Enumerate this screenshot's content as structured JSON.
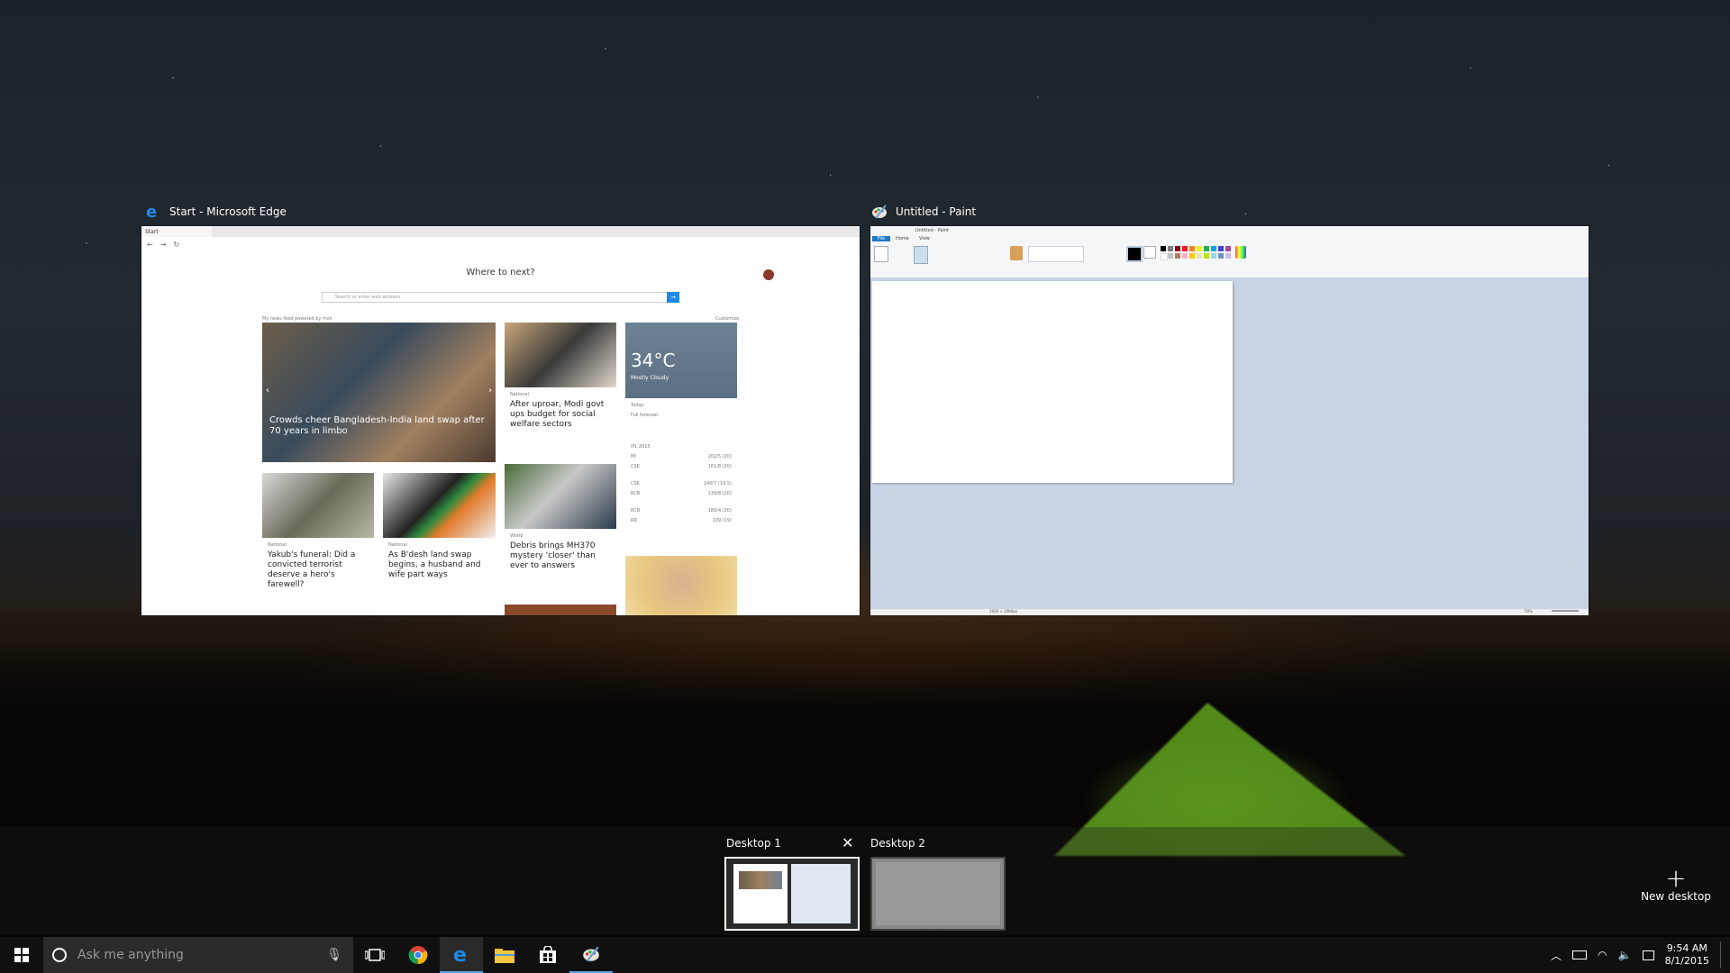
{
  "windows": [
    {
      "title": "Start - Microsoft Edge",
      "icon": "edge-icon"
    },
    {
      "title": "Untitled - Paint",
      "icon": "paint-icon"
    }
  ],
  "edge": {
    "tab_label": "Start",
    "heading": "Where to next?",
    "search_placeholder": "Search or enter web address",
    "feed_label": "My news feed",
    "feed_powered": "powered by msn",
    "customize": "Customize",
    "headline_main": "Crowds cheer Bangladesh-India land swap after 70 years in limbo",
    "story2": {
      "category": "National",
      "title": "After uproar, Modi govt ups budget for social welfare sectors"
    },
    "story3": {
      "category": "National",
      "title": "Yakub's funeral: Did a convicted terrorist deserve a hero's farewell?"
    },
    "story4": {
      "category": "National",
      "title": "As B'desh land swap begins, a husband and wife part ways"
    },
    "story5": {
      "category": "World",
      "title": "Debris brings MH370 mystery 'closer' than ever to answers"
    },
    "weather": {
      "temp": "34°C",
      "condition": "Mostly Cloudy",
      "today": "Today",
      "forecast": "Full forecast"
    },
    "ipl_label": "IPL 2015",
    "scores": [
      {
        "team": "MI",
        "score": "202/5 (20)"
      },
      {
        "team": "CSK",
        "score": "161/8 (20)"
      },
      {
        "team": "CSK",
        "score": "140/7 (19.5)"
      },
      {
        "team": "RCB",
        "score": "139/8 (20)"
      },
      {
        "team": "RCB",
        "score": "180/4 (20)"
      },
      {
        "team": "RR",
        "score": "109 (19)"
      }
    ]
  },
  "paint": {
    "tabs": [
      "File",
      "Home",
      "View"
    ],
    "title_small": "Untitled - Paint",
    "status_size": "1920 × 1080px",
    "zoom": "50%"
  },
  "desktops": [
    {
      "label": "Desktop 1"
    },
    {
      "label": "Desktop 2"
    }
  ],
  "new_desktop_label": "New desktop",
  "taskbar": {
    "search_placeholder": "Ask me anything",
    "time": "9:54 AM",
    "date": "8/1/2015"
  }
}
